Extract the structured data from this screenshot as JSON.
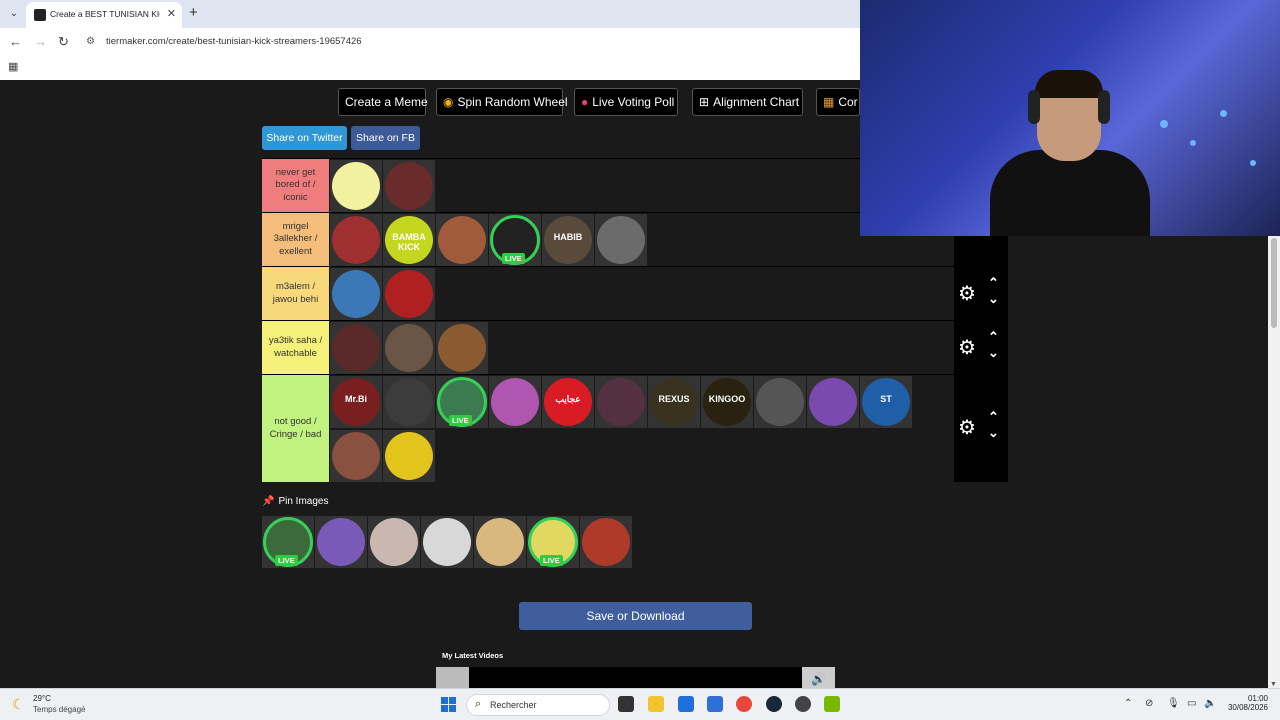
{
  "browser": {
    "tab_title": "Create a BEST TUNISIAN KICK S",
    "new_tab": "+",
    "close": "✕",
    "url": "tiermaker.com/create/best-tunisian-kick-streamers-19657426"
  },
  "toolbar": {
    "create_meme": "Create a Meme",
    "spin_wheel": "Spin Random Wheel",
    "live_poll": "Live Voting Poll",
    "alignment_chart": "Alignment Chart",
    "compare": "Cor"
  },
  "share": {
    "twitter": "Share on Twitter",
    "facebook": "Share on FB"
  },
  "tiers": [
    {
      "label": "never get bored of / iconic",
      "color": "#f07d7d"
    },
    {
      "label": "mrigel 3allekher / exellent",
      "color": "#f5bd7a"
    },
    {
      "label": "m3alem / jawou behi",
      "color": "#f7d97c"
    },
    {
      "label": "ya3tik saha / watchable",
      "color": "#f5f07a"
    },
    {
      "label": "not good / Cringe / bad",
      "color": "#c2f27f"
    }
  ],
  "tier_items": {
    "t0": [
      {
        "color": "#f1f1a0"
      },
      {
        "color": "#6a2b2b"
      }
    ],
    "t1": [
      {
        "color": "#a03030"
      },
      {
        "color": "#c5d61f",
        "text": "BAMBA KICK"
      },
      {
        "color": "#a05a3c"
      },
      {
        "color": "#222222",
        "live": true
      },
      {
        "color": "#5a4a3c",
        "text": "HABIB"
      },
      {
        "color": "#6b6b6b"
      }
    ],
    "t2": [
      {
        "color": "#3a78b8"
      },
      {
        "color": "#b02020"
      }
    ],
    "t3": [
      {
        "color": "#5a2a2a"
      },
      {
        "color": "#6b5546"
      },
      {
        "color": "#8a5a30"
      }
    ],
    "t4a": [
      {
        "color": "#7a1f1f",
        "text": "Mr.Bi"
      },
      {
        "color": "#3c3c3c"
      },
      {
        "color": "#3c7a50",
        "live": true
      },
      {
        "color": "#b056b0"
      },
      {
        "color": "#d81b24",
        "text": "عجايب"
      },
      {
        "color": "#553040"
      },
      {
        "color": "#3a3220",
        "text": "REXUS"
      },
      {
        "color": "#2a2210",
        "text": "KINGOO"
      },
      {
        "color": "#555555"
      },
      {
        "color": "#7a4ab0"
      },
      {
        "color": "#1f5fa8",
        "text": "ST"
      }
    ],
    "t4b": [
      {
        "color": "#8a5040"
      },
      {
        "color": "#e3c41c"
      }
    ]
  },
  "pin": {
    "label": "Pin Images"
  },
  "pool": [
    {
      "color": "#3c6a3c",
      "live": true
    },
    {
      "color": "#7a5ab8"
    },
    {
      "color": "#c8b8b0"
    },
    {
      "color": "#d8d8d8"
    },
    {
      "color": "#d9b880"
    },
    {
      "color": "#e0d860",
      "live": true
    },
    {
      "color": "#b03a2a"
    }
  ],
  "live_label": "LIVE",
  "save_label": "Save or Download",
  "latest_label": "My Latest Videos",
  "taskbar": {
    "temp": "29°C",
    "weather": "Temps dégagé",
    "search_placeholder": "Rechercher",
    "time": "01:00",
    "date": "30/08/2026"
  }
}
